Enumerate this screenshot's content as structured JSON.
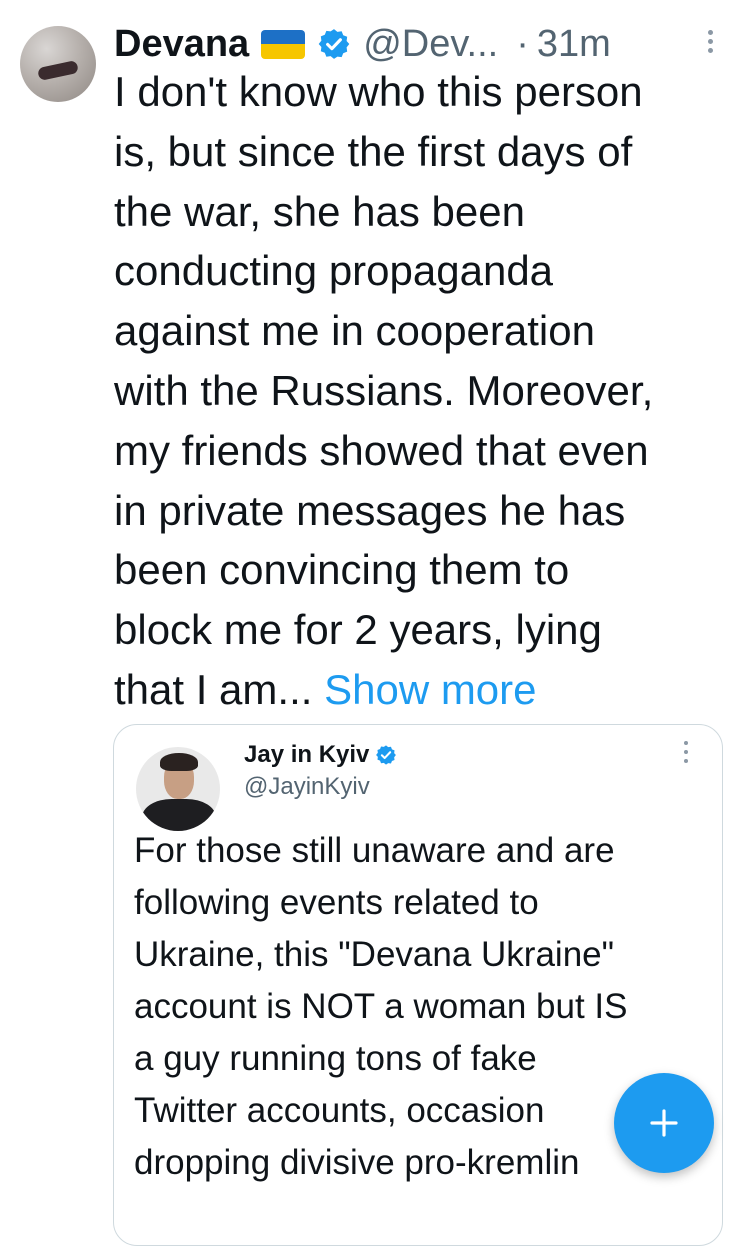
{
  "tweet": {
    "author_name": "Devana",
    "author_handle": "@Dev...",
    "separator": "·",
    "time": "31m",
    "text_lines": [
      "I don't know who this person",
      "is, but since the first days of",
      "the war, she has been",
      "conducting propaganda",
      "against me in cooperation",
      "with the Russians. Moreover,",
      "my friends showed that even",
      "in private messages he has",
      "been convincing them to",
      "block me for 2 years, lying",
      "that I am..."
    ],
    "show_more_label": "Show more"
  },
  "quote": {
    "author_name": "Jay in Kyiv",
    "author_handle": "@JayinKyiv",
    "text_lines": [
      "For those still unaware and are",
      "following events related to",
      "Ukraine, this \"Devana Ukraine\"",
      "account is NOT a woman but IS",
      "a guy running tons of fake",
      "Twitter accounts, occasion",
      "dropping divisive pro-kremlin"
    ]
  },
  "icons": {
    "flag": "ukraine-flag-icon",
    "verified": "verified-badge-icon",
    "more": "more-options-icon",
    "compose": "plus-icon"
  },
  "colors": {
    "accent": "#1d9bf0",
    "secondary_text": "#536471",
    "flag_blue": "#1d70c6",
    "flag_yellow": "#f6c600"
  }
}
